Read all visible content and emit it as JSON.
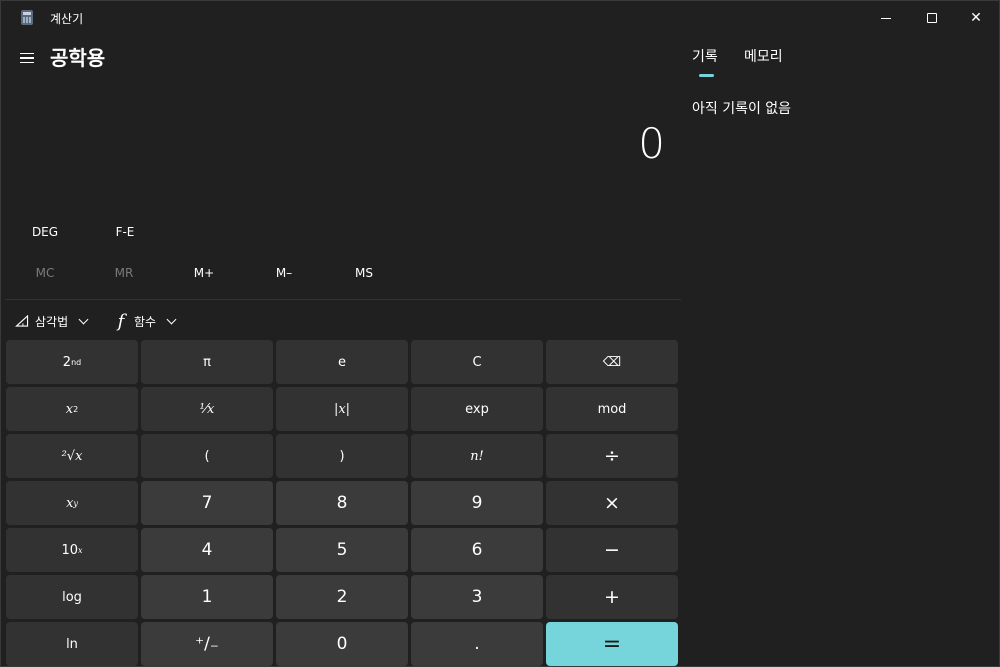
{
  "window": {
    "title": "계산기",
    "min_symbol": "",
    "max_symbol": "",
    "close_symbol": "✕"
  },
  "header": {
    "mode_title": "공학용"
  },
  "display": {
    "value": "0"
  },
  "toggles": {
    "deg": "DEG",
    "fe": "F-E"
  },
  "memory": {
    "mc": "MC",
    "mr": "MR",
    "mplus": "M+",
    "mminus": "M–",
    "ms": "MS"
  },
  "dropdowns": {
    "trig": "삼각법",
    "func_icon": "f",
    "func": "함수"
  },
  "keys": {
    "second_base": "2",
    "second_sup": "nd",
    "pi": "π",
    "e": "e",
    "clear": "C",
    "backspace": "⌫",
    "square_base": "x",
    "square_sup": "2",
    "reciprocal": "⅟x",
    "abs": "|x|",
    "exp": "exp",
    "mod": "mod",
    "sqrt": "²√x",
    "open_paren": "(",
    "close_paren": ")",
    "factorial": "n!",
    "divide": "÷",
    "power_base": "x",
    "power_sup": "y",
    "seven": "7",
    "eight": "8",
    "nine": "9",
    "multiply": "×",
    "ten_base": "10",
    "ten_sup": "x",
    "four": "4",
    "five": "5",
    "six": "6",
    "minus": "−",
    "log": "log",
    "one": "1",
    "two": "2",
    "three": "3",
    "plus": "+",
    "ln": "ln",
    "negate": "⁺∕₋",
    "zero": "0",
    "decimal": ".",
    "equals": "="
  },
  "side_panel": {
    "tab_history": "기록",
    "tab_memory": "메모리",
    "empty_message": "아직 기록이 없음"
  },
  "colors": {
    "background": "#202020",
    "key": "#3b3b3b",
    "key_fn": "#323232",
    "accent": "#76d5db"
  }
}
